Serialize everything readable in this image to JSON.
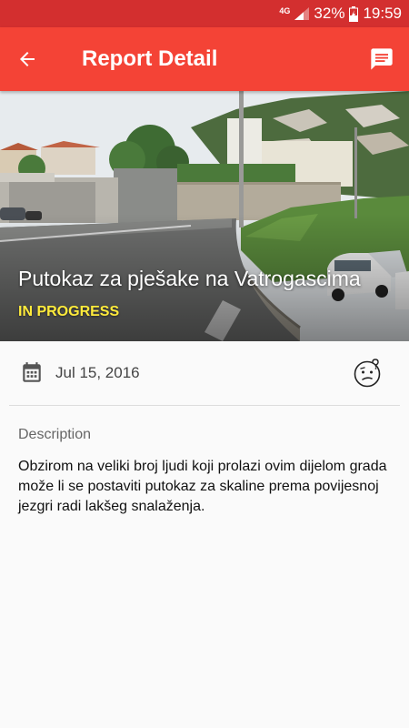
{
  "status_bar": {
    "network": "4G",
    "battery": "32%",
    "time": "19:59"
  },
  "app_bar": {
    "title": "Report Detail",
    "back_icon": "arrow-back-icon",
    "action_icon": "feedback-icon"
  },
  "report": {
    "title": "Putokaz za pješake na Vatrogascima",
    "status": "IN PROGRESS",
    "date": "Jul 15, 2016",
    "date_icon": "calendar-icon",
    "mood_icon": "confused-face-icon",
    "description_label": "Description",
    "description": "Obzirom na veliki broj ljudi koji prolazi ovim dijelom grada može li se postaviti putokaz za skaline prema povijesnoj jezgri radi lakšeg snalaženja."
  },
  "colors": {
    "status_bar": "#d32f2f",
    "app_bar": "#f44336",
    "status_text": "#ffeb3b"
  }
}
